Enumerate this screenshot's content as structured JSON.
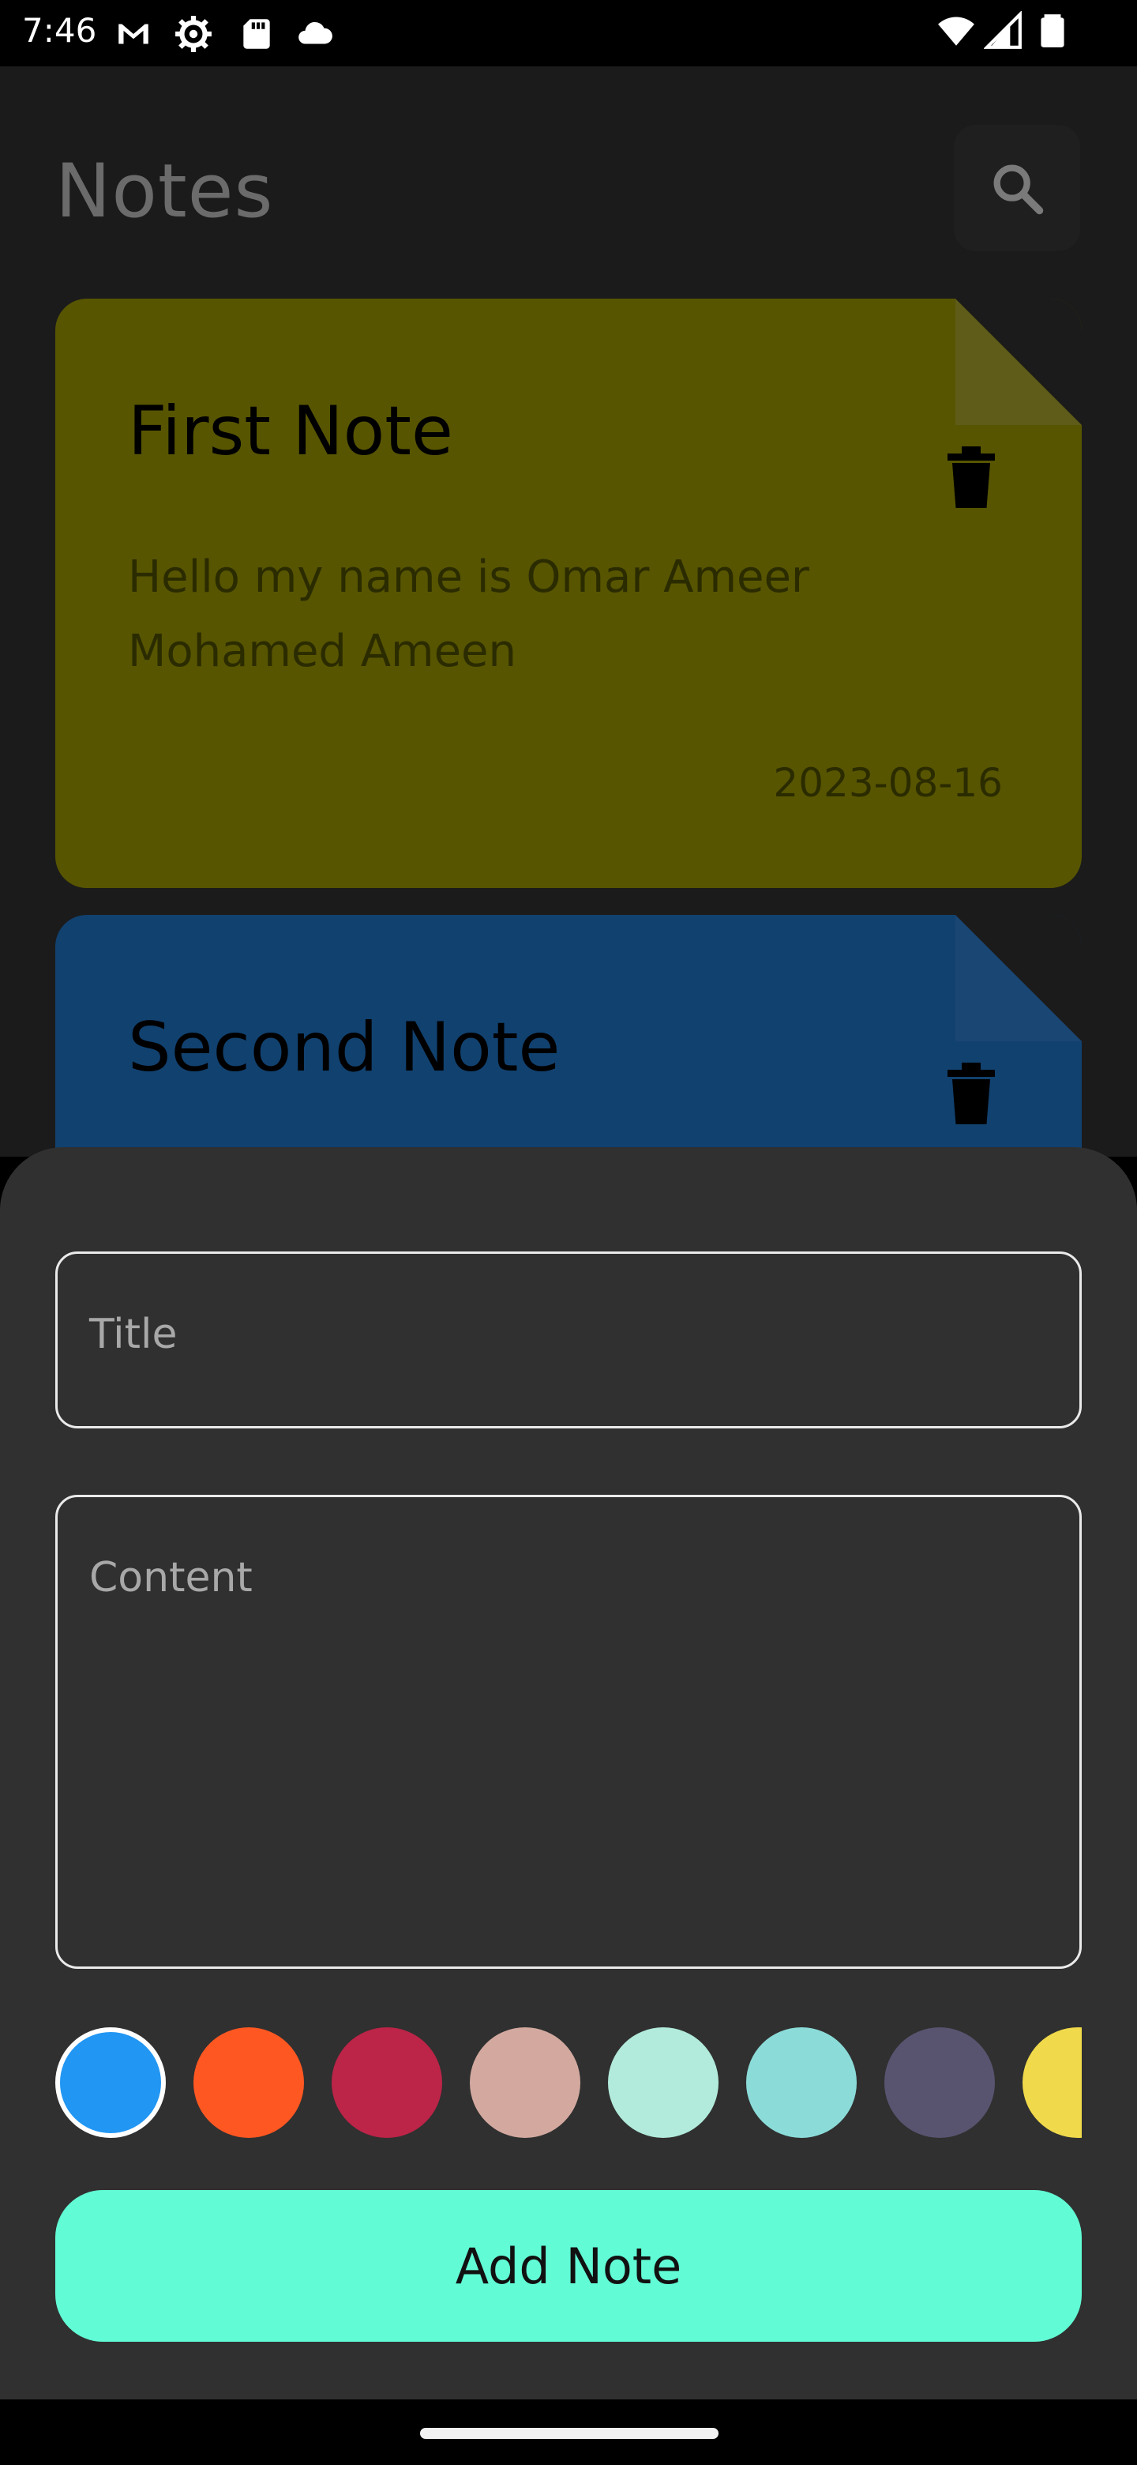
{
  "status_bar": {
    "time": "7:46",
    "left_icons": [
      "gmail-icon",
      "settings-icon",
      "sd-card-icon",
      "cloud-icon"
    ],
    "right_icons": [
      "wifi-icon",
      "signal-icon",
      "battery-icon"
    ]
  },
  "header": {
    "title": "Notes",
    "search_icon": "search-icon"
  },
  "notes": [
    {
      "title": "First Note",
      "content": "Hello my name is Omar Ameer Mohamed Ameen",
      "date": "2023-08-16",
      "color": "#575500"
    },
    {
      "title": "Second Note",
      "content": "",
      "date": "",
      "color": "#11416f"
    }
  ],
  "sheet": {
    "title_placeholder": "Title",
    "content_placeholder": "Content",
    "colors": [
      "#2196f3",
      "#ff5722",
      "#bc2448",
      "#d3a99f",
      "#b2ebdb",
      "#8bdcd9",
      "#585470",
      "#f0da4b"
    ],
    "selected_color": "#2196f3",
    "add_button_label": "Add Note",
    "add_button_color": "#61fcd5"
  }
}
